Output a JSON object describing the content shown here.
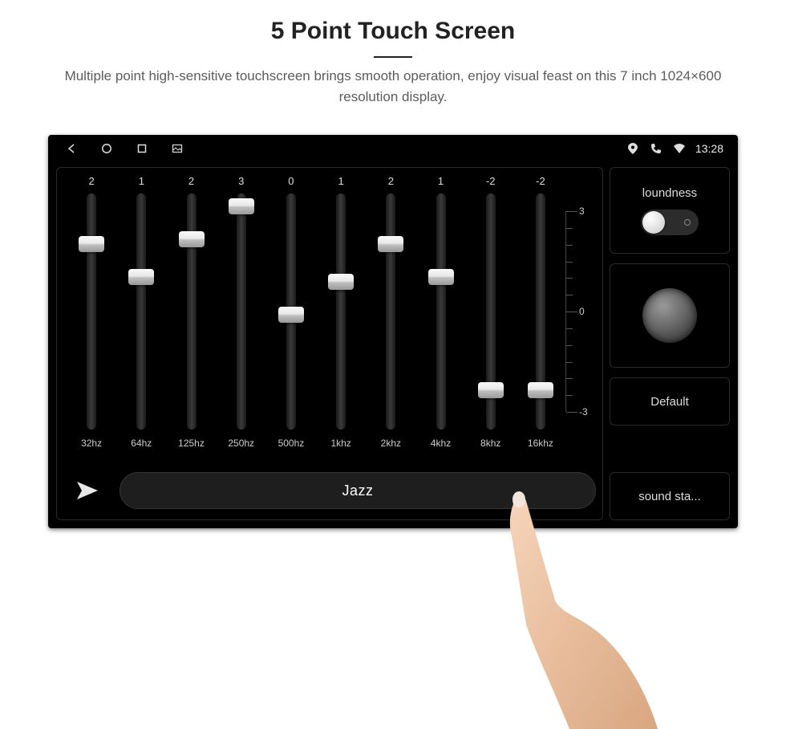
{
  "header": {
    "title": "5 Point Touch Screen",
    "subtitle": "Multiple point high-sensitive touchscreen brings smooth operation, enjoy visual feast on this 7 inch 1024×600 resolution display."
  },
  "sysbar": {
    "clock": "13:28"
  },
  "eq": {
    "bands": [
      {
        "freq": "32hz",
        "value": "2",
        "pos": 18
      },
      {
        "freq": "64hz",
        "value": "1",
        "pos": 32
      },
      {
        "freq": "125hz",
        "value": "2",
        "pos": 16
      },
      {
        "freq": "250hz",
        "value": "3",
        "pos": 2
      },
      {
        "freq": "500hz",
        "value": "0",
        "pos": 48
      },
      {
        "freq": "1khz",
        "value": "1",
        "pos": 34
      },
      {
        "freq": "2khz",
        "value": "2",
        "pos": 18
      },
      {
        "freq": "4khz",
        "value": "1",
        "pos": 32
      },
      {
        "freq": "8khz",
        "value": "-2",
        "pos": 80
      },
      {
        "freq": "16khz",
        "value": "-2",
        "pos": 80
      }
    ],
    "scale": {
      "top": "3",
      "mid": "0",
      "bot": "-3"
    },
    "preset": "Jazz"
  },
  "side": {
    "loudness_label": "loundness",
    "default_label": "Default",
    "soundstage_label": "sound sta..."
  }
}
